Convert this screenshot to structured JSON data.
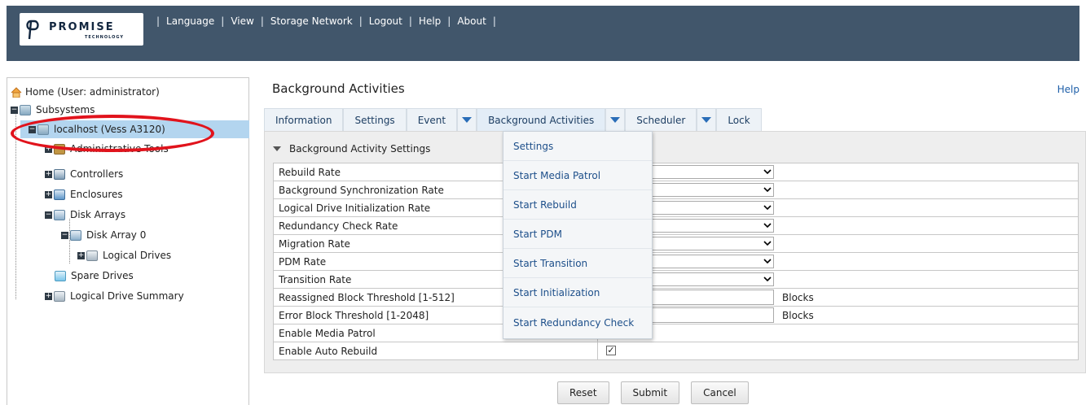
{
  "header": {
    "logo": {
      "name": "PROMISE",
      "sub": "TECHNOLOGY"
    },
    "nav": [
      "Language",
      "View",
      "Storage Network",
      "Logout",
      "Help",
      "About"
    ]
  },
  "tree": {
    "home": "Home (User: administrator)",
    "subsystems": "Subsystems",
    "host": "localhost (Vess A3120)",
    "admin_tools": "Administrative Tools",
    "controllers": "Controllers",
    "enclosures": "Enclosures",
    "disk_arrays": "Disk Arrays",
    "disk_array_0": "Disk Array 0",
    "logical_drives": "Logical Drives",
    "spare_drives": "Spare Drives",
    "ld_summary": "Logical Drive Summary"
  },
  "main": {
    "title": "Background Activities",
    "help": "Help",
    "tabs": [
      "Information",
      "Settings",
      "Event",
      "Background Activities",
      "Scheduler",
      "Lock"
    ],
    "section_title": "Background Activity Settings",
    "rows": [
      "Rebuild Rate",
      "Background Synchronization Rate",
      "Logical Drive Initialization Rate",
      "Redundancy Check Rate",
      "Migration Rate",
      "PDM Rate",
      "Transition Rate",
      "Reassigned Block Threshold [1-512]",
      "Error Block Threshold [1-2048]",
      "Enable Media Patrol",
      "Enable Auto Rebuild"
    ],
    "unit_blocks": "Blocks",
    "auto_rebuild_checked": "✓",
    "menu": [
      "Settings",
      "Start Media Patrol",
      "Start Rebuild",
      "Start PDM",
      "Start Transition",
      "Start Initialization",
      "Start Redundancy Check"
    ],
    "buttons": {
      "reset": "Reset",
      "submit": "Submit",
      "cancel": "Cancel"
    }
  },
  "colors": {
    "header_bg": "#41566b",
    "tab_text": "#1d3e63",
    "menu_text": "#1d4f8a",
    "selection": "#b3d5ef",
    "annotation_red": "#e1131c"
  }
}
